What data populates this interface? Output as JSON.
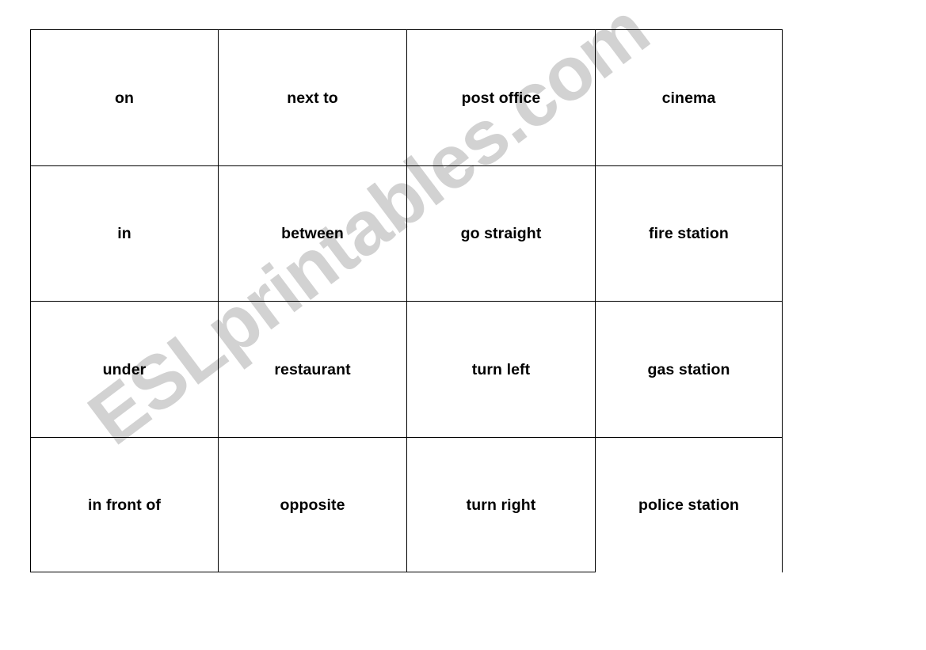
{
  "document": {
    "type": "vocabulary-flashcard-grid",
    "rows": 4,
    "columns": 4,
    "text_color": "#000000",
    "border_color": "#000000",
    "background_color": "#ffffff"
  },
  "watermark": {
    "text": "ESLprintables.com",
    "color": "#d2d2d2",
    "rotation_degrees": -37
  },
  "cards": [
    [
      {
        "label": "on"
      },
      {
        "label": "next to"
      },
      {
        "label": "post office"
      },
      {
        "label": "cinema"
      }
    ],
    [
      {
        "label": "in"
      },
      {
        "label": "between"
      },
      {
        "label": "go straight"
      },
      {
        "label": "fire station"
      }
    ],
    [
      {
        "label": "under"
      },
      {
        "label": "restaurant"
      },
      {
        "label": "turn left"
      },
      {
        "label": "gas station"
      }
    ],
    [
      {
        "label": "in front of"
      },
      {
        "label": "opposite"
      },
      {
        "label": "turn right"
      },
      {
        "label": "police station"
      }
    ]
  ]
}
